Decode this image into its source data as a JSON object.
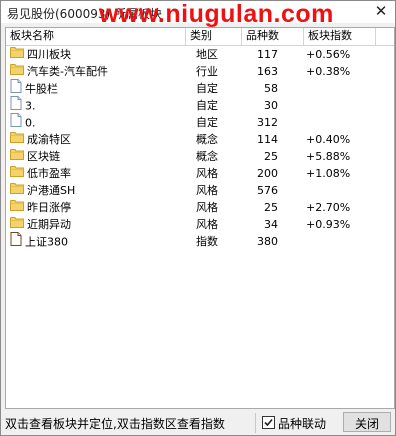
{
  "window": {
    "title": "易见股份(600093)    所属板块",
    "watermark": "www.niugulan.com",
    "close_glyph": "✕"
  },
  "columns": {
    "name": "板块名称",
    "type": "类别",
    "count": "品种数",
    "index": "板块指数"
  },
  "rows": [
    {
      "name": "四川板块",
      "type": "地区",
      "count": "117",
      "index": "+0.56%",
      "icon": "folder-icon"
    },
    {
      "name": "汽车类-汽车配件",
      "type": "行业",
      "count": "163",
      "index": "+0.38%",
      "icon": "folder-icon"
    },
    {
      "name": "牛股栏",
      "type": "自定",
      "count": "58",
      "index": "",
      "icon": "document-icon"
    },
    {
      "name": "3.",
      "type": "自定",
      "count": "30",
      "index": "",
      "icon": "document-icon"
    },
    {
      "name": "0.",
      "type": "自定",
      "count": "312",
      "index": "",
      "icon": "document-icon"
    },
    {
      "name": "成渝特区",
      "type": "概念",
      "count": "114",
      "index": "+0.40%",
      "icon": "folder-icon"
    },
    {
      "name": "区块链",
      "type": "概念",
      "count": "25",
      "index": "+5.88%",
      "icon": "folder-icon"
    },
    {
      "name": "低市盈率",
      "type": "风格",
      "count": "200",
      "index": "+1.08%",
      "icon": "folder-icon"
    },
    {
      "name": "沪港通SH",
      "type": "风格",
      "count": "576",
      "index": "",
      "icon": "folder-icon"
    },
    {
      "name": "昨日涨停",
      "type": "风格",
      "count": "25",
      "index": "+2.70%",
      "icon": "folder-icon"
    },
    {
      "name": "近期异动",
      "type": "风格",
      "count": "34",
      "index": "+0.93%",
      "icon": "folder-icon"
    },
    {
      "name": "上证380",
      "type": "指数",
      "count": "380",
      "index": "",
      "icon": "index-doc-icon"
    }
  ],
  "status": {
    "hint": "双击查看板块并定位,双击指数区查看指数",
    "linkage_label": "品种联动",
    "linkage_checked": true,
    "close_button": "关闭"
  },
  "colors": {
    "watermark": "#ee1111",
    "folder": "#f5d36a",
    "folder_stroke": "#c9a227"
  }
}
